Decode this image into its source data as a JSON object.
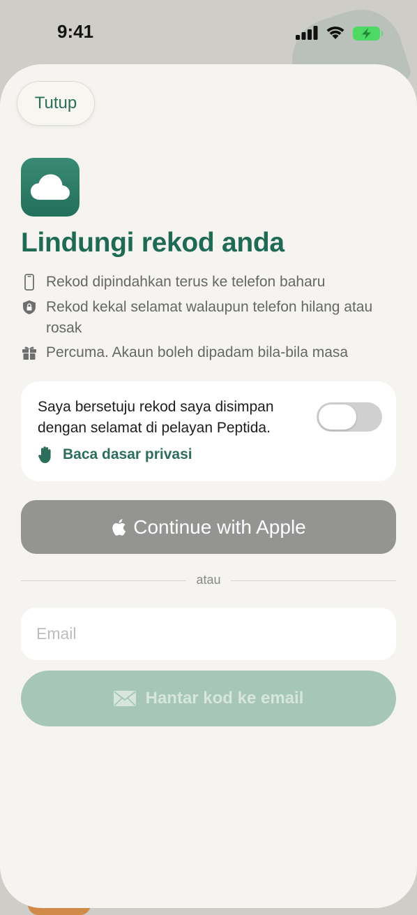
{
  "status_bar": {
    "time": "9:41"
  },
  "colors": {
    "accent": "#2c6e5b",
    "title": "#1f6a55",
    "apple_button": "#949493",
    "send_button_disabled": "#a6c6ba",
    "battery_charging": "#4cd964"
  },
  "sheet": {
    "close_label": "Tutup",
    "app_icon": "cloud-icon",
    "title": "Lindungi rekod anda",
    "features": [
      {
        "icon": "phone-icon",
        "text": "Rekod dipindahkan terus ke telefon baharu"
      },
      {
        "icon": "shield-lock-icon",
        "text": "Rekod kekal selamat walaupun telefon hilang atau rosak"
      },
      {
        "icon": "gift-icon",
        "text": "Percuma. Akaun boleh dipadam bila-bila masa"
      }
    ],
    "consent": {
      "text": "Saya bersetuju rekod saya disimpan dengan selamat di pelayan Peptida.",
      "toggle_on": false,
      "privacy_link": "Baca dasar privasi"
    },
    "apple_button": "Continue with Apple",
    "divider_text": "atau",
    "email": {
      "placeholder": "Email",
      "value": ""
    },
    "send_button": "Hantar kod ke email"
  }
}
